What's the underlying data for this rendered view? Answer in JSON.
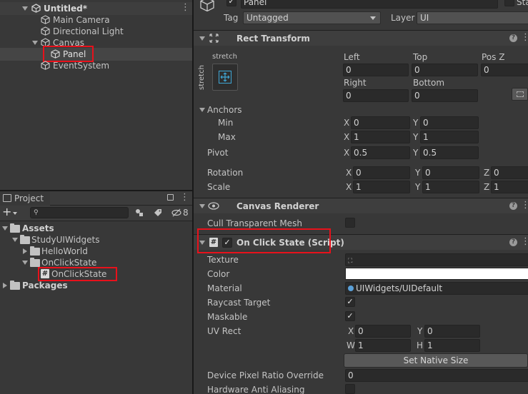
{
  "hierarchy": {
    "scene": "Untitled*",
    "items": [
      {
        "label": "Main Camera"
      },
      {
        "label": "Directional Light"
      },
      {
        "label": "Canvas"
      },
      {
        "label": "Panel"
      },
      {
        "label": "EventSystem"
      }
    ]
  },
  "project": {
    "tab": "Project",
    "add_label": "+",
    "hidden_count": "8",
    "tree": {
      "assets": "Assets",
      "study": "StudyUIWidgets",
      "hello": "HelloWorld",
      "onclickstate_folder": "OnClickState",
      "onclickstate_script": "OnClickState",
      "packages": "Packages"
    }
  },
  "inspector": {
    "object_name": "Panel",
    "static_label": "Sta",
    "tag_label": "Tag",
    "tag_value": "Untagged",
    "layer_label": "Layer",
    "layer_value": "UI",
    "rect_transform": {
      "title": "Rect Transform",
      "anchor_preset": "stretch",
      "anchor_preset_side": "stretch",
      "left_label": "Left",
      "left": "0",
      "top_label": "Top",
      "top": "0",
      "posz_label": "Pos Z",
      "posz": "0",
      "right_label": "Right",
      "right": "0",
      "bottom_label": "Bottom",
      "bottom": "0",
      "anchors_label": "Anchors",
      "min_label": "Min",
      "min_x": "0",
      "min_y": "0",
      "max_label": "Max",
      "max_x": "1",
      "max_y": "1",
      "pivot_label": "Pivot",
      "pivot_x": "0.5",
      "pivot_y": "0.5",
      "rotation_label": "Rotation",
      "rot_x": "0",
      "rot_y": "0",
      "rot_z": "0",
      "scale_label": "Scale",
      "scale_x": "1",
      "scale_y": "1",
      "scale_z": "1"
    },
    "canvas_renderer": {
      "title": "Canvas Renderer",
      "cull_label": "Cull Transparent Mesh"
    },
    "on_click_state": {
      "title": "On Click State (Script)",
      "texture_label": "Texture",
      "color_label": "Color",
      "material_label": "Material",
      "material_value": "UIWidgets/UIDefault",
      "raycast_label": "Raycast Target",
      "maskable_label": "Maskable",
      "uvrect_label": "UV Rect",
      "uv_x": "0",
      "uv_y": "0",
      "uv_w": "1",
      "uv_h": "1",
      "set_native_size": "Set Native Size",
      "dpr_label": "Device Pixel Ratio Override",
      "dpr_value": "0",
      "haa_label": "Hardware Anti Aliasing"
    },
    "axis": {
      "x": "X",
      "y": "Y",
      "z": "Z",
      "w": "W",
      "h": "H"
    },
    "colors": {
      "highlight": "#e8111b",
      "selection": "#454545"
    }
  }
}
